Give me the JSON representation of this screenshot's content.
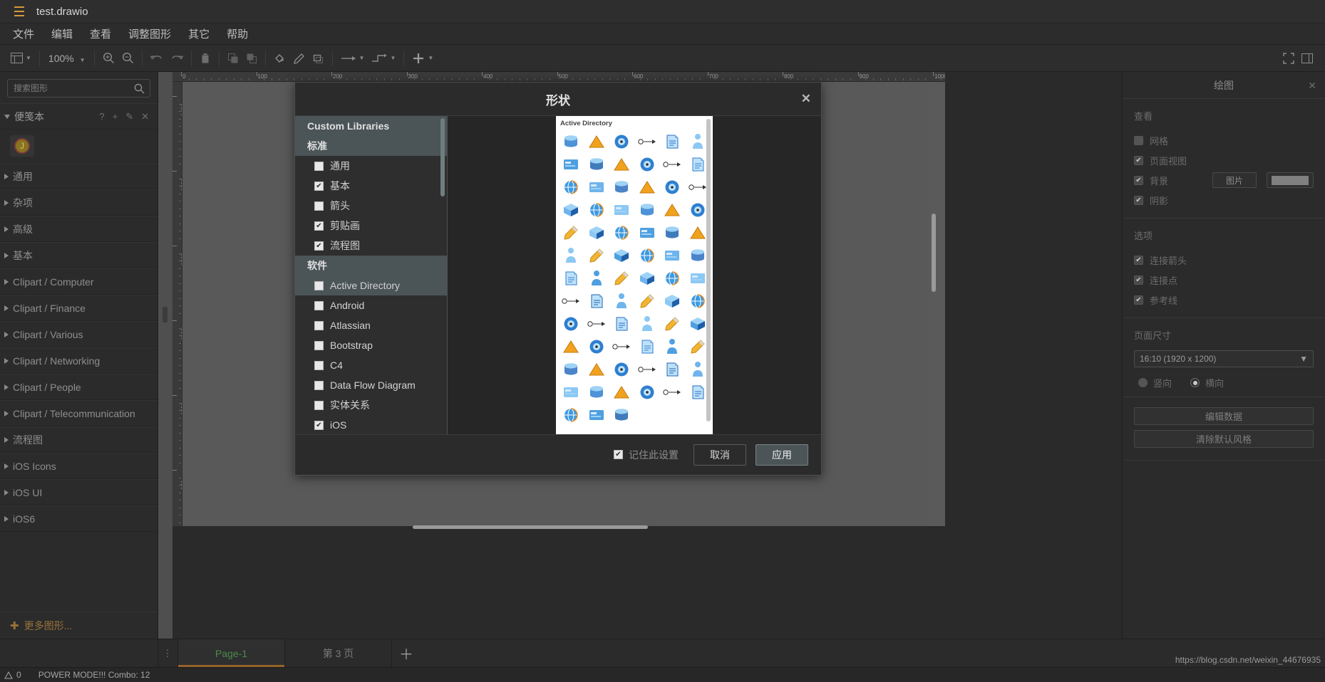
{
  "titlebar": {
    "filename": "test.drawio",
    "menu_icon": "hamburger-icon"
  },
  "menubar": {
    "items": [
      {
        "label": "文件"
      },
      {
        "label": "编辑"
      },
      {
        "label": "查看"
      },
      {
        "label": "调整图形"
      },
      {
        "label": "其它"
      },
      {
        "label": "帮助"
      }
    ]
  },
  "toolbar": {
    "zoom_level": "100%",
    "buttons": [
      {
        "name": "view-layout",
        "icon": "panel-icon"
      },
      {
        "name": "zoom-in",
        "icon": "zoom-in-icon"
      },
      {
        "name": "zoom-out",
        "icon": "zoom-out-icon"
      },
      {
        "name": "undo",
        "icon": "undo-icon"
      },
      {
        "name": "redo",
        "icon": "redo-icon"
      },
      {
        "name": "delete",
        "icon": "trash-icon"
      },
      {
        "name": "to-front",
        "icon": "to-front-icon"
      },
      {
        "name": "to-back",
        "icon": "to-back-icon"
      },
      {
        "name": "fill-color",
        "icon": "fill-icon"
      },
      {
        "name": "line-color",
        "icon": "pen-icon"
      },
      {
        "name": "shadow",
        "icon": "shadow-icon"
      },
      {
        "name": "connection",
        "icon": "arrow-icon"
      },
      {
        "name": "waypoints",
        "icon": "waypoint-icon"
      },
      {
        "name": "insert",
        "icon": "plus-icon"
      },
      {
        "name": "fullscreen",
        "icon": "fullscreen-icon"
      },
      {
        "name": "format-panel",
        "icon": "format-panel-icon"
      }
    ]
  },
  "sidebar": {
    "search": {
      "placeholder": "搜索图形",
      "value": ""
    },
    "scratchpad": {
      "label": "便笺本",
      "actions": [
        "?",
        "+",
        "✎",
        "✕"
      ],
      "shape_letter": "J"
    },
    "sections": [
      {
        "label": "通用"
      },
      {
        "label": "杂项"
      },
      {
        "label": "高级"
      },
      {
        "label": "基本"
      },
      {
        "label": "Clipart / Computer"
      },
      {
        "label": "Clipart / Finance"
      },
      {
        "label": "Clipart / Various"
      },
      {
        "label": "Clipart / Networking"
      },
      {
        "label": "Clipart / People"
      },
      {
        "label": "Clipart / Telecommunication"
      },
      {
        "label": "流程图"
      },
      {
        "label": "iOS Icons"
      },
      {
        "label": "iOS UI"
      },
      {
        "label": "iOS6"
      }
    ],
    "more_shapes": "更多图形..."
  },
  "rulers": {
    "horizontal_ticks": [
      "0",
      "100",
      "200",
      "300",
      "400",
      "500",
      "600",
      "700",
      "800",
      "900",
      "1000"
    ],
    "vertical_ticks": [
      "1400",
      "1300",
      "1200",
      "1100",
      "1000",
      "920"
    ]
  },
  "right_panel": {
    "title": "绘图",
    "close_icon": "close-icon",
    "view": {
      "heading": "查看",
      "items": [
        {
          "label": "网格",
          "checked": false
        },
        {
          "label": "页面视图",
          "checked": true
        },
        {
          "label": "背景",
          "checked": true
        },
        {
          "label": "阴影",
          "checked": true
        }
      ],
      "image_button": "图片",
      "color_swatch": "#808080"
    },
    "options": {
      "heading": "选项",
      "items": [
        {
          "label": "连接箭头",
          "checked": true
        },
        {
          "label": "连接点",
          "checked": true
        },
        {
          "label": "参考线",
          "checked": true
        }
      ]
    },
    "page_size": {
      "heading": "页面尺寸",
      "selected": "16:10 (1920 x 1200)",
      "orientation": [
        {
          "label": "竖向",
          "selected": false
        },
        {
          "label": "横向",
          "selected": true
        }
      ]
    },
    "buttons": [
      {
        "label": "编辑数据"
      },
      {
        "label": "清除默认风格"
      }
    ]
  },
  "tabbar": {
    "tabs": [
      {
        "label": "Page-1",
        "active": true
      },
      {
        "label": "第 3 页",
        "active": false
      }
    ],
    "add_icon": "plus-icon",
    "menu_icon": "dots-icon"
  },
  "statusbar": {
    "warn_icon": "warning-icon",
    "warn_count": "0",
    "message": "POWER MODE!!! Combo: 12"
  },
  "watermark": "https://blog.csdn.net/weixin_44676935",
  "dialog": {
    "title": "形状",
    "close_icon": "close-icon",
    "groups": [
      {
        "heading": "Custom Libraries",
        "items": []
      },
      {
        "heading": "标准",
        "items": [
          {
            "label": "通用",
            "checked": false
          },
          {
            "label": "基本",
            "checked": true
          },
          {
            "label": "箭头",
            "checked": false
          },
          {
            "label": "剪贴画",
            "checked": true
          },
          {
            "label": "流程图",
            "checked": true
          }
        ]
      },
      {
        "heading": "软件",
        "items": [
          {
            "label": "Active Directory",
            "checked": false,
            "highlighted": true
          },
          {
            "label": "Android",
            "checked": false
          },
          {
            "label": "Atlassian",
            "checked": false
          },
          {
            "label": "Bootstrap",
            "checked": false
          },
          {
            "label": "C4",
            "checked": false
          },
          {
            "label": "Data Flow Diagram",
            "checked": false
          },
          {
            "label": "实体关系",
            "checked": false
          },
          {
            "label": "iOS",
            "checked": true
          }
        ]
      }
    ],
    "preview": {
      "label": "Active Directory",
      "columns": 6,
      "rows": 13
    },
    "footer": {
      "remember_label": "记住此设置",
      "remember_checked": true,
      "cancel_label": "取消",
      "apply_label": "应用"
    }
  }
}
